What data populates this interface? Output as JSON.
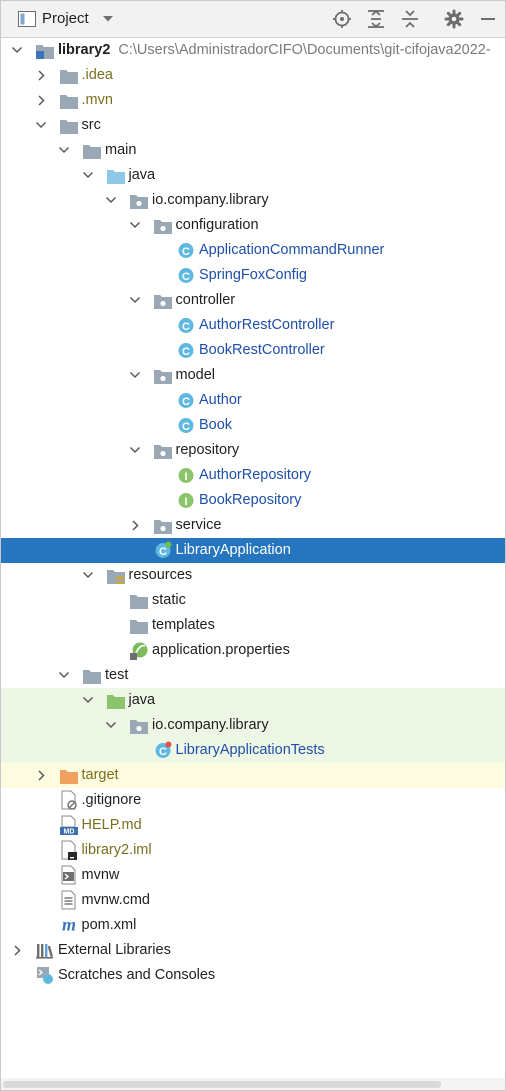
{
  "toolbar": {
    "title": "Project",
    "icons": [
      "project-view-icon",
      "dropdown-chevron-icon",
      "locate-icon",
      "expand-all-icon",
      "collapse-all-icon",
      "settings-gear-icon",
      "hide-minimize-icon"
    ]
  },
  "tree": {
    "rows": [
      {
        "label": "library2",
        "path": "C:\\Users\\AdministradorCIFO\\Documents\\git-cifojava2022-",
        "icon": "module-folder",
        "arrow": "down",
        "indent": 0
      },
      {
        "label": ".idea",
        "icon": "folder",
        "arrow": "right",
        "indent": 1
      },
      {
        "label": ".mvn",
        "icon": "folder",
        "arrow": "right",
        "indent": 1
      },
      {
        "label": "src",
        "icon": "folder",
        "arrow": "down",
        "indent": 1
      },
      {
        "label": "main",
        "icon": "folder",
        "arrow": "down",
        "indent": 2
      },
      {
        "label": "java",
        "icon": "source-folder",
        "arrow": "down",
        "indent": 3
      },
      {
        "label": "io.company.library",
        "icon": "package",
        "arrow": "down",
        "indent": 4
      },
      {
        "label": "configuration",
        "icon": "package",
        "arrow": "down",
        "indent": 5
      },
      {
        "label": "ApplicationCommandRunner",
        "icon": "class",
        "arrow": "none",
        "indent": 6
      },
      {
        "label": "SpringFoxConfig",
        "icon": "class",
        "arrow": "none",
        "indent": 6
      },
      {
        "label": "controller",
        "icon": "package",
        "arrow": "down",
        "indent": 5
      },
      {
        "label": "AuthorRestController",
        "icon": "class",
        "arrow": "none",
        "indent": 6
      },
      {
        "label": "BookRestController",
        "icon": "class",
        "arrow": "none",
        "indent": 6
      },
      {
        "label": "model",
        "icon": "package",
        "arrow": "down",
        "indent": 5
      },
      {
        "label": "Author",
        "icon": "class",
        "arrow": "none",
        "indent": 6
      },
      {
        "label": "Book",
        "icon": "class",
        "arrow": "none",
        "indent": 6
      },
      {
        "label": "repository",
        "icon": "package",
        "arrow": "down",
        "indent": 5
      },
      {
        "label": "AuthorRepository",
        "icon": "interface",
        "arrow": "none",
        "indent": 6
      },
      {
        "label": "BookRepository",
        "icon": "interface",
        "arrow": "none",
        "indent": 6
      },
      {
        "label": "service",
        "icon": "package",
        "arrow": "right",
        "indent": 5
      },
      {
        "label": "LibraryApplication",
        "icon": "spring-class",
        "arrow": "none",
        "indent": 5
      },
      {
        "label": "resources",
        "icon": "resources-folder",
        "arrow": "down",
        "indent": 3
      },
      {
        "label": "static",
        "icon": "folder",
        "arrow": "none",
        "indent": 4
      },
      {
        "label": "templates",
        "icon": "folder",
        "arrow": "none",
        "indent": 4
      },
      {
        "label": "application.properties",
        "icon": "spring-properties",
        "arrow": "none",
        "indent": 4
      },
      {
        "label": "test",
        "icon": "folder",
        "arrow": "down",
        "indent": 2
      },
      {
        "label": "java",
        "icon": "test-folder",
        "arrow": "down",
        "indent": 3
      },
      {
        "label": "io.company.library",
        "icon": "package",
        "arrow": "down",
        "indent": 4
      },
      {
        "label": "LibraryApplicationTests",
        "icon": "test-class",
        "arrow": "none",
        "indent": 5
      },
      {
        "label": "target",
        "icon": "excluded-folder",
        "arrow": "right",
        "indent": 1
      },
      {
        "label": ".gitignore",
        "icon": "ignore-file",
        "arrow": "none",
        "indent": 1
      },
      {
        "label": "HELP.md",
        "icon": "markdown-file",
        "arrow": "none",
        "indent": 1
      },
      {
        "label": "library2.iml",
        "icon": "iml-file",
        "arrow": "none",
        "indent": 1
      },
      {
        "label": "mvnw",
        "icon": "shell-file",
        "arrow": "none",
        "indent": 1
      },
      {
        "label": "mvnw.cmd",
        "icon": "text-file",
        "arrow": "none",
        "indent": 1
      },
      {
        "label": "pom.xml",
        "icon": "maven-file",
        "arrow": "none",
        "indent": 1
      },
      {
        "label": "External Libraries",
        "icon": "libraries",
        "arrow": "right",
        "indent": 0
      },
      {
        "label": "Scratches and Consoles",
        "icon": "scratches",
        "arrow": "none",
        "indent": 0
      }
    ]
  },
  "colors": {
    "accent_selection": "#2675bf",
    "class_link": "#1f4fa8",
    "test_highlight": "#eef7e6",
    "excluded_highlight": "#fdfbe0",
    "modified_file": "#7a6f1e"
  }
}
